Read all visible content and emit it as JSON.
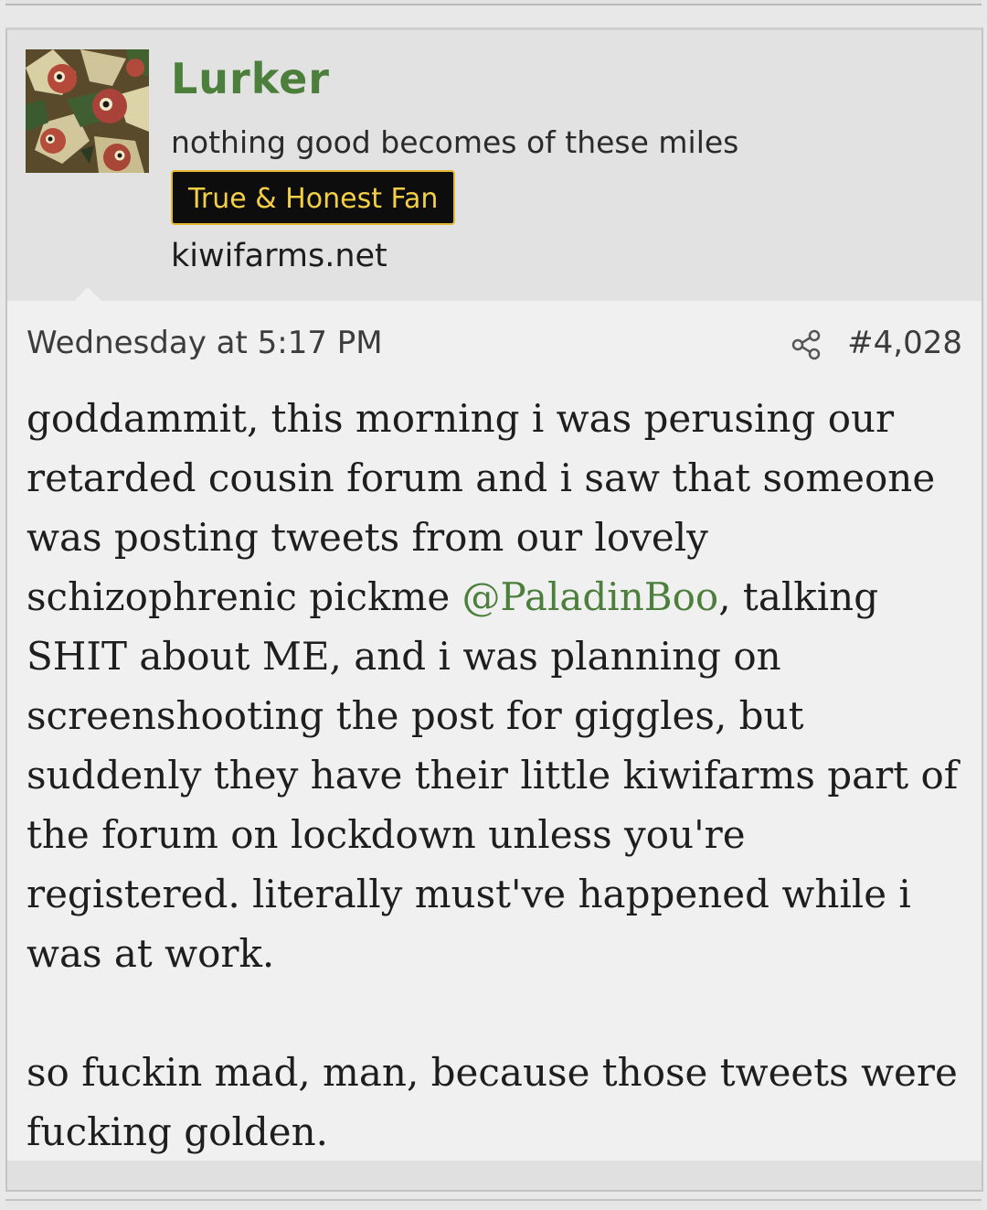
{
  "post": {
    "author": {
      "name": "Lurker",
      "title": "nothing good becomes of these miles",
      "banner": "True & Honest Fan",
      "site": "kiwifarms.net",
      "avatar_icon": "avatar-image"
    },
    "date": "Wednesday at 5:17 PM",
    "share_icon": "share-icon",
    "number": "#4,028",
    "body": {
      "p1_part1": "goddammit, this morning i was perusing our retarded cousin forum and i saw that someone was posting tweets from our lovely schizophrenic pickme ",
      "mention": "@PaladinBoo",
      "p1_part2": ", talking SHIT about ME, and i was planning on screenshooting the post for giggles, but suddenly they have their little kiwifarms part of the forum on lockdown unless you're registered. literally must've happened while i was at work.",
      "p2": "so fuckin mad, man, because those tweets were fucking golden."
    }
  },
  "colors": {
    "username": "#4d7f3c",
    "mention": "#4d7f3c",
    "banner_bg": "#0d0d0d",
    "banner_text": "#f3cf45",
    "header_bg": "#e2e2e2",
    "post_bg": "#f0f0f0"
  }
}
